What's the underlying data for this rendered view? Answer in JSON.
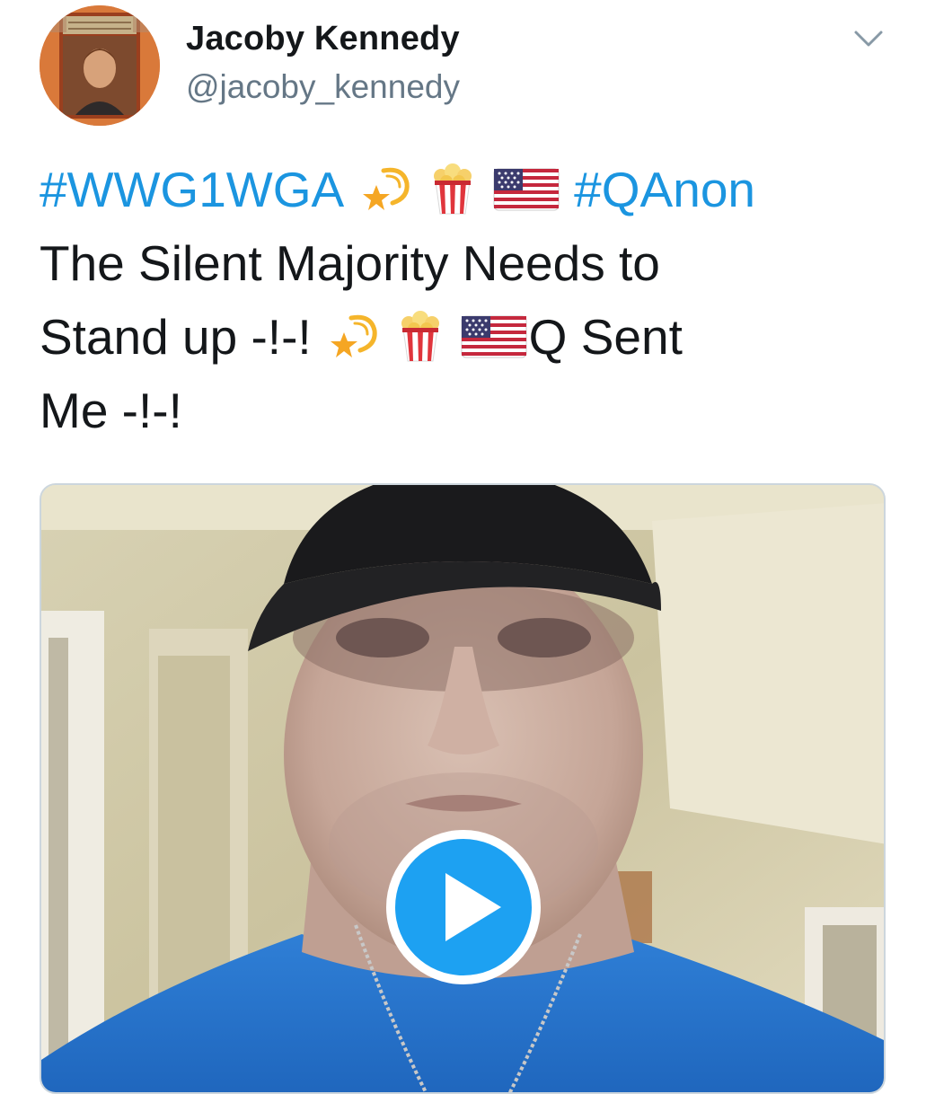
{
  "author": {
    "display_name": "Jacoby Kennedy",
    "handle": "@jacoby_kennedy",
    "avatar_icon": "book-cover-avatar"
  },
  "menu": {
    "icon": "chevron-down-icon"
  },
  "tweet": {
    "hashtag_1": "#WWG1WGA",
    "hashtag_2": "#QAnon",
    "line_2": "The Silent Majority Needs to",
    "line_3_start": "Stand up -!-!",
    "line_3_end": "Q Sent",
    "line_4": "Me -!-!",
    "emoji": [
      "dizzy-star-icon",
      "popcorn-icon",
      "us-flag-icon"
    ]
  },
  "media": {
    "type": "video",
    "play_icon": "play-icon"
  },
  "colors": {
    "link": "#1b95e0",
    "text": "#14171a",
    "secondary": "#657786",
    "play_button": "#1da1f2"
  }
}
